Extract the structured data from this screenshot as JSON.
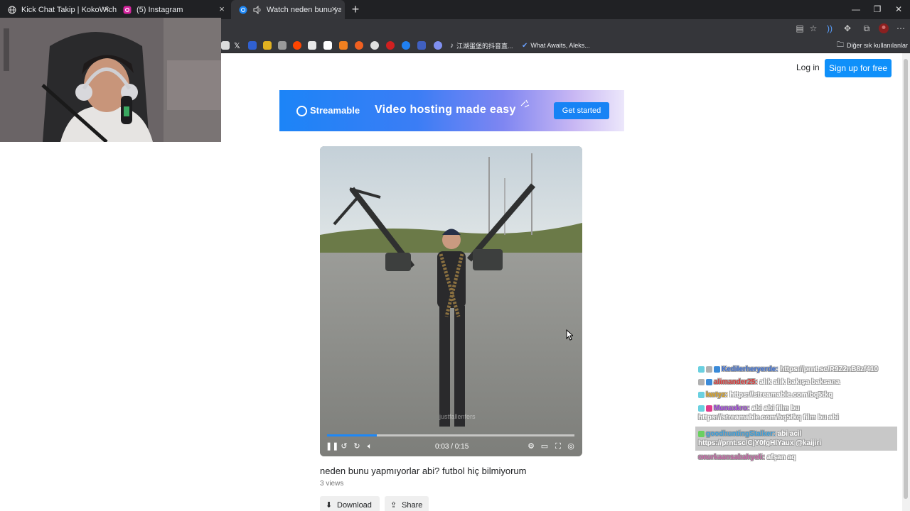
{
  "tabs": [
    {
      "title": "Kick Chat Takip | KokoWich",
      "icon": "globe-icon"
    },
    {
      "title": "(5) Instagram",
      "icon": "instagram-icon"
    },
    {
      "title": "Watch neden bunu yapmıyor",
      "icon": "streamable-icon",
      "active": true
    }
  ],
  "bookmarks": {
    "item1": "江湖蛋堡的抖音直...",
    "item2": "What Awaits, Aleks...",
    "other": "Diğer sık kullanılanlar"
  },
  "header": {
    "login": "Log in",
    "signup": "Sign up for free"
  },
  "banner": {
    "brand": "Streamable",
    "headline": "Video hosting made easy",
    "cta": "Get started"
  },
  "player": {
    "time": "0:03 / 0:15",
    "watermark": "justfallenfers",
    "progress_fraction": 0.2
  },
  "video": {
    "title": "neden bunu yapmıyorlar abi? futbol hiç bilmiyorum",
    "views": "3 views",
    "download": "Download",
    "share": "Share"
  },
  "chat": [
    {
      "user": "Kedilerheryerde:",
      "user_color": "#3a6fd8",
      "text": "https://prnt.sc/R9Z2nB8zf410"
    },
    {
      "user": "alimander25:",
      "user_color": "#d83a3a",
      "text": "alık alık bakışa baksana"
    },
    {
      "user": "kwtyz:",
      "user_color": "#d8a01e",
      "text": "https://streamable.com/bq5tkq"
    },
    {
      "user": "Munaxkro:",
      "user_color": "#9b3ad8",
      "text": "abi abi film bu https://streamable.com/bq5tkq film bu abi"
    },
    {
      "user": "goodhuntingStalker:",
      "user_color": "#3a9dd8",
      "text": "abi acil https://prnt.sc/CjY0fgHlYaux @kaijiri"
    },
    {
      "user": "onurkaansabahyeli:",
      "user_color": "#c060a0",
      "text": "afşan aq"
    }
  ],
  "colors": {
    "accent": "#0f90fa",
    "chrome_dark": "#202124",
    "chrome_toolbar": "#35363a"
  }
}
